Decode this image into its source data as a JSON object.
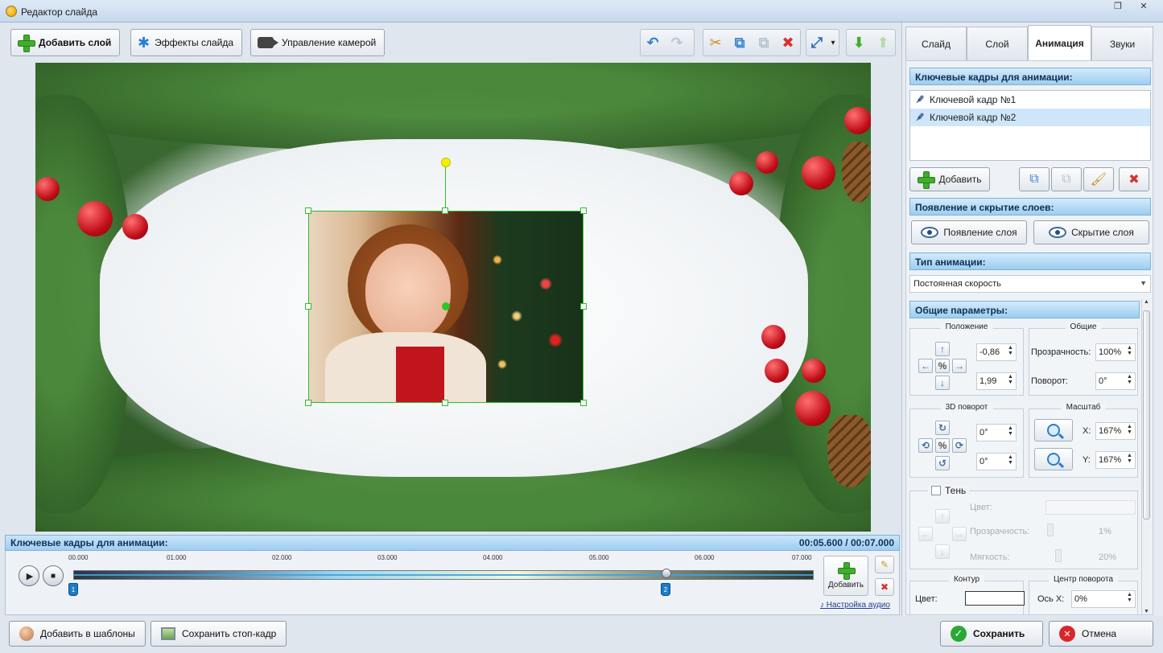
{
  "window": {
    "title": "Редактор слайда",
    "restore_glyph": "❐",
    "close_glyph": "✕"
  },
  "toolbar": {
    "add_layer": "Добавить слой",
    "slide_effects": "Эффекты слайда",
    "camera_control": "Управление камерой",
    "undo_glyph": "↶",
    "redo_glyph": "↷",
    "cut_glyph": "✂",
    "copy_glyph": "⧉",
    "paste_glyph": "⧉",
    "delete_glyph": "✖",
    "fit_glyph": "⤢",
    "fit_arrow": "▾",
    "move_down_glyph": "⬇",
    "move_up_glyph": "⬆"
  },
  "timeline": {
    "title": "Ключевые кадры для анимации:",
    "time": "00:05.600 / 00:07.000",
    "ticks": [
      "00.000",
      "01.000",
      "02.000",
      "03.000",
      "04.000",
      "05.000",
      "06.000",
      "07.000"
    ],
    "markers": [
      "1",
      "2"
    ],
    "add_label": "Добавить",
    "audio_link": "Настройка аудио",
    "play_glyph": "▶",
    "stop_glyph": "■",
    "edit_glyph": "✎",
    "delete_glyph": "✖",
    "note_glyph": "♪"
  },
  "bottom": {
    "add_templates": "Добавить в шаблоны",
    "save_frame": "Сохранить стоп-кадр",
    "save": "Сохранить",
    "cancel": "Отмена"
  },
  "tabs": [
    {
      "label": "Слайд"
    },
    {
      "label": "Слой"
    },
    {
      "label": "Анимация"
    },
    {
      "label": "Звуки"
    }
  ],
  "panel": {
    "keyframes_head": "Ключевые кадры для анимации:",
    "keyframes": [
      "Ключевой кадр №1",
      "Ключевой кадр №2"
    ],
    "add_btn": "Добавить",
    "appear_head": "Появление и скрытие слоев:",
    "appear_btn": "Появление слоя",
    "hide_btn": "Скрытие слоя",
    "anim_type_head": "Тип анимации:",
    "anim_type_value": "Постоянная скорость",
    "anim_type_arrow": "▼",
    "general_head": "Общие параметры:",
    "position_title": "Положение",
    "pos_x": "-0,86",
    "pos_y": "1,99",
    "common_title": "Общие",
    "opacity_label": "Прозрачность:",
    "opacity_value": "100%",
    "rotation_label": "Поворот:",
    "rotation_value": "0°",
    "rot3d_title": "3D поворот",
    "rot3d_a": "0°",
    "rot3d_b": "0°",
    "scale_title": "Масштаб",
    "scale_x_label": "X:",
    "scale_x": "167%",
    "scale_y_label": "Y:",
    "scale_y": "167%",
    "shadow_label": "Тень",
    "shadow_color": "Цвет:",
    "shadow_opacity": "Прозрачность:",
    "shadow_opacity_value": "1%",
    "shadow_softness": "Мягкость:",
    "shadow_softness_value": "20%",
    "contour_title": "Контур",
    "contour_color": "Цвет:",
    "pivot_title": "Центр поворота",
    "pivot_x_label": "Ось X:",
    "pivot_x": "0%",
    "arrow_up": "↑",
    "arrow_down": "↓",
    "arrow_left": "←",
    "arrow_right": "→",
    "percent_glyph": "%",
    "rot_a_glyph": "↻",
    "rot_b_glyph": "↺",
    "rot_c_glyph": "⟲",
    "rot_d_glyph": "⟳",
    "spin_glyph": "▲▼",
    "scroll_up": "▲",
    "scroll_down": "▼"
  }
}
